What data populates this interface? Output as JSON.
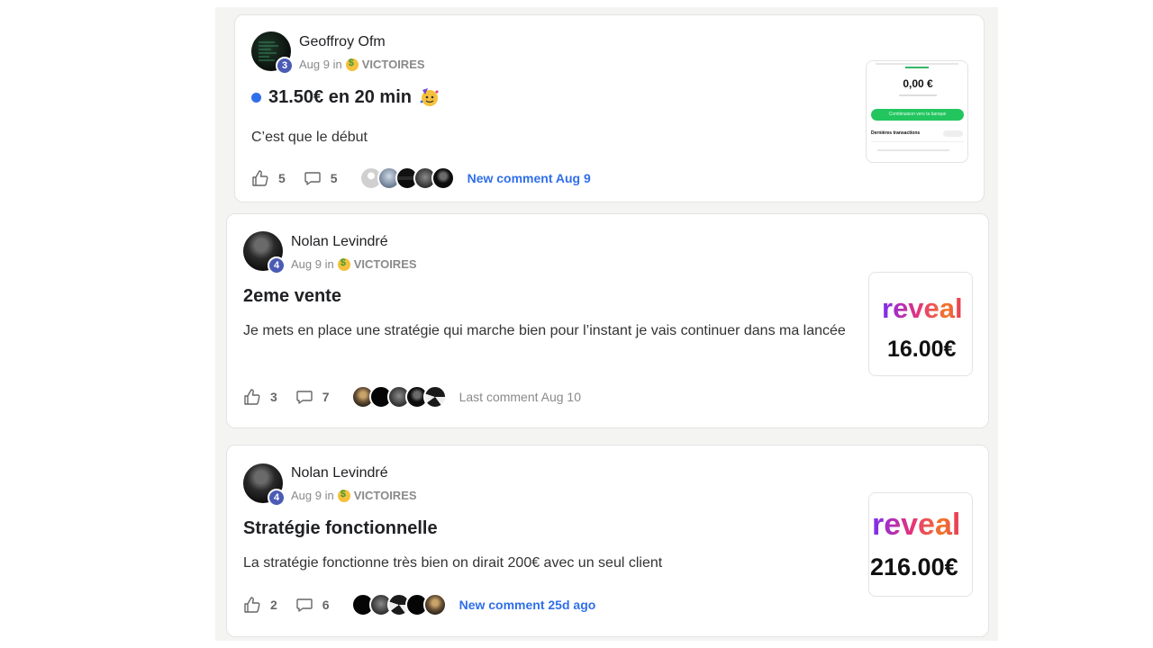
{
  "posts": [
    {
      "author": "Geoffroy Ofm",
      "level": "3",
      "date": "Aug 9 in",
      "category": "VICTOIRES",
      "title": "31.50€ en 20 min",
      "body": "C’est que le début",
      "likes": "5",
      "comments": "5",
      "last_comment": "New comment Aug 9",
      "thumbnail": {
        "balance": "0,00 €",
        "button_label": "Combinaison vers ta banque",
        "section": "Dernières transactions"
      }
    },
    {
      "author": "Nolan Levindré",
      "level": "4",
      "date": "Aug 9 in",
      "category": "VICTOIRES",
      "title": "2eme vente",
      "body": "Je mets en place une stratégie qui marche bien pour l’instant je vais continuer dans ma lancée",
      "likes": "3",
      "comments": "7",
      "last_comment": "Last comment Aug 10",
      "thumbnail": {
        "brand": "reveal",
        "amount": "16.00€"
      }
    },
    {
      "author": "Nolan Levindré",
      "level": "4",
      "date": "Aug 9 in",
      "category": "VICTOIRES",
      "title": "Stratégie fonctionnelle",
      "body": "La stratégie fonctionne très bien on dirait 200€ avec un seul client",
      "likes": "2",
      "comments": "6",
      "last_comment": "New comment 25d ago",
      "thumbnail": {
        "brand": "reveal",
        "amount": "216.00€"
      }
    }
  ],
  "colors": {
    "accent_blue": "#2f6fea",
    "level_badge": "#4b5bb5",
    "feed_bg": "#f4f4f3"
  }
}
